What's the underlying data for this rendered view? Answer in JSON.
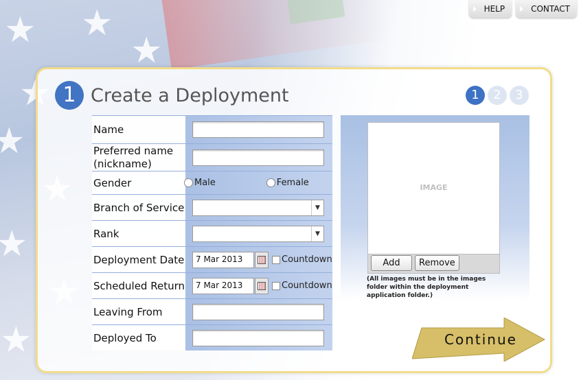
{
  "topnav": {
    "help": "HELP",
    "contact": "CONTACT"
  },
  "header": {
    "step_number": "1",
    "title": "Create a Deployment"
  },
  "steps": [
    "1",
    "2",
    "3"
  ],
  "form": {
    "name_label": "Name",
    "preferred_label_line1": "Preferred name",
    "preferred_label_line2": "(nickname)",
    "gender_label": "Gender",
    "gender_male": "Male",
    "gender_female": "Female",
    "branch_label": "Branch of Service",
    "rank_label": "Rank",
    "deployment_date_label": "Deployment Date",
    "deployment_date_value": "7 Mar 2013",
    "scheduled_return_label": "Scheduled Return",
    "scheduled_return_value": "7 Mar 2013",
    "countdown_label": "Countdown",
    "leaving_from_label": "Leaving From",
    "deployed_to_label": "Deployed To"
  },
  "image_panel": {
    "placeholder": "IMAGE",
    "add_label": "Add",
    "remove_label": "Remove",
    "note": "(All images must be in the images folder within the deployment application folder.)"
  },
  "continue_label": "Continue",
  "colors": {
    "accent": "#4174c2",
    "panel_border": "#f2dc8a",
    "continue_fill": "#d6bf68"
  }
}
